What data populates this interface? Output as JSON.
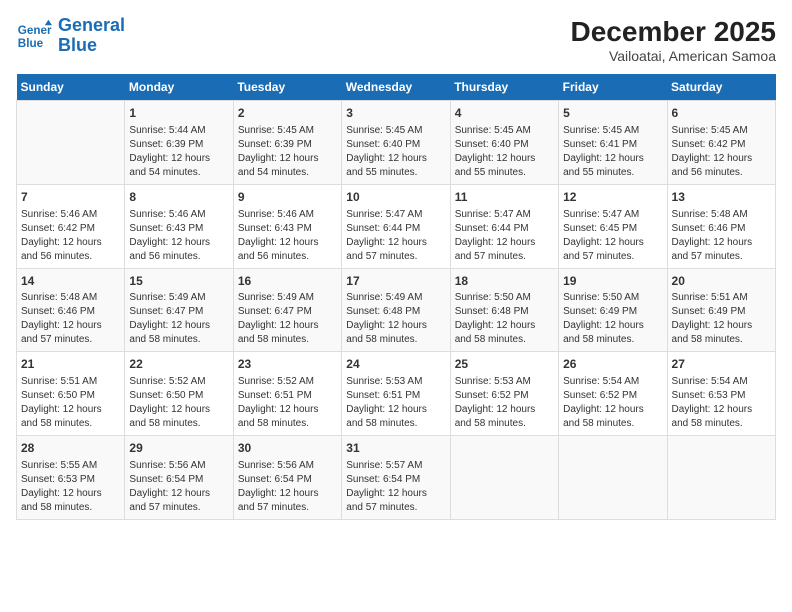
{
  "header": {
    "logo_line1": "General",
    "logo_line2": "Blue",
    "title": "December 2025",
    "subtitle": "Vailoatai, American Samoa"
  },
  "days_of_week": [
    "Sunday",
    "Monday",
    "Tuesday",
    "Wednesday",
    "Thursday",
    "Friday",
    "Saturday"
  ],
  "weeks": [
    [
      {
        "day": "",
        "content": ""
      },
      {
        "day": "1",
        "content": "Sunrise: 5:44 AM\nSunset: 6:39 PM\nDaylight: 12 hours\nand 54 minutes."
      },
      {
        "day": "2",
        "content": "Sunrise: 5:45 AM\nSunset: 6:39 PM\nDaylight: 12 hours\nand 54 minutes."
      },
      {
        "day": "3",
        "content": "Sunrise: 5:45 AM\nSunset: 6:40 PM\nDaylight: 12 hours\nand 55 minutes."
      },
      {
        "day": "4",
        "content": "Sunrise: 5:45 AM\nSunset: 6:40 PM\nDaylight: 12 hours\nand 55 minutes."
      },
      {
        "day": "5",
        "content": "Sunrise: 5:45 AM\nSunset: 6:41 PM\nDaylight: 12 hours\nand 55 minutes."
      },
      {
        "day": "6",
        "content": "Sunrise: 5:45 AM\nSunset: 6:42 PM\nDaylight: 12 hours\nand 56 minutes."
      }
    ],
    [
      {
        "day": "7",
        "content": "Sunrise: 5:46 AM\nSunset: 6:42 PM\nDaylight: 12 hours\nand 56 minutes."
      },
      {
        "day": "8",
        "content": "Sunrise: 5:46 AM\nSunset: 6:43 PM\nDaylight: 12 hours\nand 56 minutes."
      },
      {
        "day": "9",
        "content": "Sunrise: 5:46 AM\nSunset: 6:43 PM\nDaylight: 12 hours\nand 56 minutes."
      },
      {
        "day": "10",
        "content": "Sunrise: 5:47 AM\nSunset: 6:44 PM\nDaylight: 12 hours\nand 57 minutes."
      },
      {
        "day": "11",
        "content": "Sunrise: 5:47 AM\nSunset: 6:44 PM\nDaylight: 12 hours\nand 57 minutes."
      },
      {
        "day": "12",
        "content": "Sunrise: 5:47 AM\nSunset: 6:45 PM\nDaylight: 12 hours\nand 57 minutes."
      },
      {
        "day": "13",
        "content": "Sunrise: 5:48 AM\nSunset: 6:46 PM\nDaylight: 12 hours\nand 57 minutes."
      }
    ],
    [
      {
        "day": "14",
        "content": "Sunrise: 5:48 AM\nSunset: 6:46 PM\nDaylight: 12 hours\nand 57 minutes."
      },
      {
        "day": "15",
        "content": "Sunrise: 5:49 AM\nSunset: 6:47 PM\nDaylight: 12 hours\nand 58 minutes."
      },
      {
        "day": "16",
        "content": "Sunrise: 5:49 AM\nSunset: 6:47 PM\nDaylight: 12 hours\nand 58 minutes."
      },
      {
        "day": "17",
        "content": "Sunrise: 5:49 AM\nSunset: 6:48 PM\nDaylight: 12 hours\nand 58 minutes."
      },
      {
        "day": "18",
        "content": "Sunrise: 5:50 AM\nSunset: 6:48 PM\nDaylight: 12 hours\nand 58 minutes."
      },
      {
        "day": "19",
        "content": "Sunrise: 5:50 AM\nSunset: 6:49 PM\nDaylight: 12 hours\nand 58 minutes."
      },
      {
        "day": "20",
        "content": "Sunrise: 5:51 AM\nSunset: 6:49 PM\nDaylight: 12 hours\nand 58 minutes."
      }
    ],
    [
      {
        "day": "21",
        "content": "Sunrise: 5:51 AM\nSunset: 6:50 PM\nDaylight: 12 hours\nand 58 minutes."
      },
      {
        "day": "22",
        "content": "Sunrise: 5:52 AM\nSunset: 6:50 PM\nDaylight: 12 hours\nand 58 minutes."
      },
      {
        "day": "23",
        "content": "Sunrise: 5:52 AM\nSunset: 6:51 PM\nDaylight: 12 hours\nand 58 minutes."
      },
      {
        "day": "24",
        "content": "Sunrise: 5:53 AM\nSunset: 6:51 PM\nDaylight: 12 hours\nand 58 minutes."
      },
      {
        "day": "25",
        "content": "Sunrise: 5:53 AM\nSunset: 6:52 PM\nDaylight: 12 hours\nand 58 minutes."
      },
      {
        "day": "26",
        "content": "Sunrise: 5:54 AM\nSunset: 6:52 PM\nDaylight: 12 hours\nand 58 minutes."
      },
      {
        "day": "27",
        "content": "Sunrise: 5:54 AM\nSunset: 6:53 PM\nDaylight: 12 hours\nand 58 minutes."
      }
    ],
    [
      {
        "day": "28",
        "content": "Sunrise: 5:55 AM\nSunset: 6:53 PM\nDaylight: 12 hours\nand 58 minutes."
      },
      {
        "day": "29",
        "content": "Sunrise: 5:56 AM\nSunset: 6:54 PM\nDaylight: 12 hours\nand 57 minutes."
      },
      {
        "day": "30",
        "content": "Sunrise: 5:56 AM\nSunset: 6:54 PM\nDaylight: 12 hours\nand 57 minutes."
      },
      {
        "day": "31",
        "content": "Sunrise: 5:57 AM\nSunset: 6:54 PM\nDaylight: 12 hours\nand 57 minutes."
      },
      {
        "day": "",
        "content": ""
      },
      {
        "day": "",
        "content": ""
      },
      {
        "day": "",
        "content": ""
      }
    ]
  ]
}
